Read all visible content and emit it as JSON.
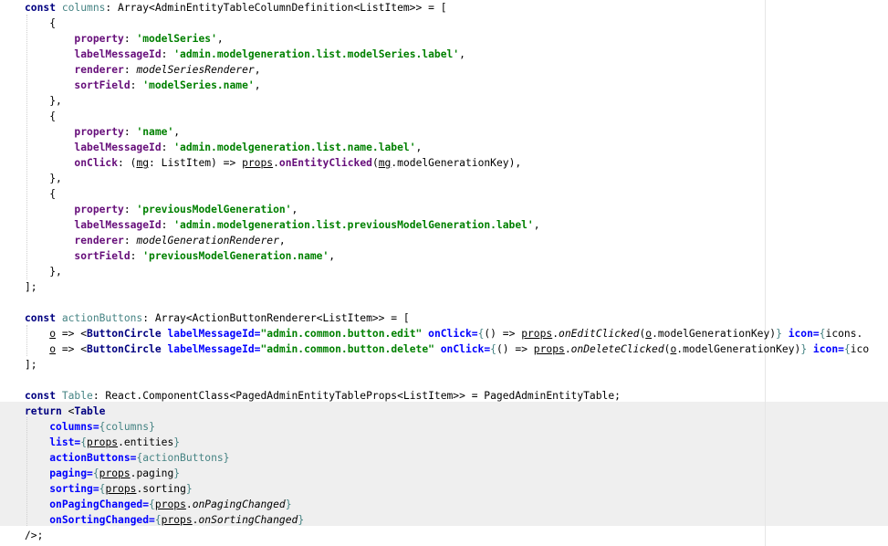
{
  "editor": {
    "lines": [
      [
        {
          "t": "const ",
          "c": "kw"
        },
        {
          "t": "columns",
          "c": "dec"
        },
        {
          "t": ": Array<AdminEntityTableColumnDefinition<ListItem>> = ["
        }
      ],
      [
        {
          "t": "    {"
        }
      ],
      [
        {
          "t": "        "
        },
        {
          "t": "property",
          "c": "prop"
        },
        {
          "t": ": "
        },
        {
          "t": "'modelSeries'",
          "c": "str"
        },
        {
          "t": ","
        }
      ],
      [
        {
          "t": "        "
        },
        {
          "t": "labelMessageId",
          "c": "prop"
        },
        {
          "t": ": "
        },
        {
          "t": "'admin.modelgeneration.list.modelSeries.label'",
          "c": "str"
        },
        {
          "t": ","
        }
      ],
      [
        {
          "t": "        "
        },
        {
          "t": "renderer",
          "c": "prop"
        },
        {
          "t": ": "
        },
        {
          "t": "modelSeriesRenderer",
          "c": "ital"
        },
        {
          "t": ","
        }
      ],
      [
        {
          "t": "        "
        },
        {
          "t": "sortField",
          "c": "prop"
        },
        {
          "t": ": "
        },
        {
          "t": "'modelSeries.name'",
          "c": "str"
        },
        {
          "t": ","
        }
      ],
      [
        {
          "t": "    },"
        }
      ],
      [
        {
          "t": "    {"
        }
      ],
      [
        {
          "t": "        "
        },
        {
          "t": "property",
          "c": "prop"
        },
        {
          "t": ": "
        },
        {
          "t": "'name'",
          "c": "str"
        },
        {
          "t": ","
        }
      ],
      [
        {
          "t": "        "
        },
        {
          "t": "labelMessageId",
          "c": "prop"
        },
        {
          "t": ": "
        },
        {
          "t": "'admin.modelgeneration.list.name.label'",
          "c": "str"
        },
        {
          "t": ","
        }
      ],
      [
        {
          "t": "        "
        },
        {
          "t": "onClick",
          "c": "prop"
        },
        {
          "t": ": ("
        },
        {
          "t": "mg",
          "c": "ul"
        },
        {
          "t": ": ListItem) => "
        },
        {
          "t": "props",
          "c": "ul"
        },
        {
          "t": "."
        },
        {
          "t": "onEntityClicked",
          "c": "prop"
        },
        {
          "t": "("
        },
        {
          "t": "mg",
          "c": "ul"
        },
        {
          "t": ".modelGenerationKey),"
        }
      ],
      [
        {
          "t": "    },"
        }
      ],
      [
        {
          "t": "    {"
        }
      ],
      [
        {
          "t": "        "
        },
        {
          "t": "property",
          "c": "prop"
        },
        {
          "t": ": "
        },
        {
          "t": "'previousModelGeneration'",
          "c": "str"
        },
        {
          "t": ","
        }
      ],
      [
        {
          "t": "        "
        },
        {
          "t": "labelMessageId",
          "c": "prop"
        },
        {
          "t": ": "
        },
        {
          "t": "'admin.modelgeneration.list.previousModelGeneration.label'",
          "c": "str"
        },
        {
          "t": ","
        }
      ],
      [
        {
          "t": "        "
        },
        {
          "t": "renderer",
          "c": "prop"
        },
        {
          "t": ": "
        },
        {
          "t": "modelGenerationRenderer",
          "c": "ital"
        },
        {
          "t": ","
        }
      ],
      [
        {
          "t": "        "
        },
        {
          "t": "sortField",
          "c": "prop"
        },
        {
          "t": ": "
        },
        {
          "t": "'previousModelGeneration.name'",
          "c": "str"
        },
        {
          "t": ","
        }
      ],
      [
        {
          "t": "    },"
        }
      ],
      [
        {
          "t": "];"
        }
      ],
      [
        {
          "t": ""
        }
      ],
      [
        {
          "t": "const ",
          "c": "kw"
        },
        {
          "t": "actionButtons",
          "c": "dec"
        },
        {
          "t": ": Array<ActionButtonRenderer<ListItem>> = ["
        }
      ],
      [
        {
          "t": "    "
        },
        {
          "t": "o",
          "c": "ul"
        },
        {
          "t": " => <"
        },
        {
          "t": "ButtonCircle ",
          "c": "tag"
        },
        {
          "t": "labelMessageId=",
          "c": "attr"
        },
        {
          "t": "\"admin.common.button.edit\" ",
          "c": "str"
        },
        {
          "t": "onClick=",
          "c": "attr"
        },
        {
          "t": "{",
          "c": "brace"
        },
        {
          "t": "() => "
        },
        {
          "t": "props",
          "c": "ul"
        },
        {
          "t": "."
        },
        {
          "t": "onEditClicked",
          "c": "ital"
        },
        {
          "t": "("
        },
        {
          "t": "o",
          "c": "ul"
        },
        {
          "t": ".modelGenerationKey)"
        },
        {
          "t": "} ",
          "c": "brace"
        },
        {
          "t": "icon=",
          "c": "attr"
        },
        {
          "t": "{",
          "c": "brace"
        },
        {
          "t": "icons."
        }
      ],
      [
        {
          "t": "    "
        },
        {
          "t": "o",
          "c": "ul"
        },
        {
          "t": " => <"
        },
        {
          "t": "ButtonCircle ",
          "c": "tag"
        },
        {
          "t": "labelMessageId=",
          "c": "attr"
        },
        {
          "t": "\"admin.common.button.delete\" ",
          "c": "str"
        },
        {
          "t": "onClick=",
          "c": "attr"
        },
        {
          "t": "{",
          "c": "brace"
        },
        {
          "t": "() => "
        },
        {
          "t": "props",
          "c": "ul"
        },
        {
          "t": "."
        },
        {
          "t": "onDeleteClicked",
          "c": "ital"
        },
        {
          "t": "("
        },
        {
          "t": "o",
          "c": "ul"
        },
        {
          "t": ".modelGenerationKey)"
        },
        {
          "t": "} ",
          "c": "brace"
        },
        {
          "t": "icon=",
          "c": "attr"
        },
        {
          "t": "{",
          "c": "brace"
        },
        {
          "t": "ico"
        }
      ],
      [
        {
          "t": "];"
        }
      ],
      [
        {
          "t": ""
        }
      ],
      [
        {
          "t": "const ",
          "c": "kw"
        },
        {
          "t": "Table",
          "c": "dec"
        },
        {
          "t": ": React.ComponentClass<PagedAdminEntityTableProps<ListItem>> = PagedAdminEntityTable;"
        }
      ],
      [
        {
          "t": "return ",
          "c": "kw"
        },
        {
          "t": "<"
        },
        {
          "t": "Table",
          "c": "tag"
        }
      ],
      [
        {
          "t": "    "
        },
        {
          "t": "columns=",
          "c": "attr"
        },
        {
          "t": "{",
          "c": "brace"
        },
        {
          "t": "columns",
          "c": "dec"
        },
        {
          "t": "}",
          "c": "brace"
        }
      ],
      [
        {
          "t": "    "
        },
        {
          "t": "list=",
          "c": "attr"
        },
        {
          "t": "{",
          "c": "brace"
        },
        {
          "t": "props",
          "c": "ul"
        },
        {
          "t": ".entities"
        },
        {
          "t": "}",
          "c": "brace"
        }
      ],
      [
        {
          "t": "    "
        },
        {
          "t": "actionButtons=",
          "c": "attr"
        },
        {
          "t": "{",
          "c": "brace"
        },
        {
          "t": "actionButtons",
          "c": "dec"
        },
        {
          "t": "}",
          "c": "brace"
        }
      ],
      [
        {
          "t": "    "
        },
        {
          "t": "paging=",
          "c": "attr"
        },
        {
          "t": "{",
          "c": "brace"
        },
        {
          "t": "props",
          "c": "ul"
        },
        {
          "t": ".paging"
        },
        {
          "t": "}",
          "c": "brace"
        }
      ],
      [
        {
          "t": "    "
        },
        {
          "t": "sorting=",
          "c": "attr"
        },
        {
          "t": "{",
          "c": "brace"
        },
        {
          "t": "props",
          "c": "ul"
        },
        {
          "t": ".sorting"
        },
        {
          "t": "}",
          "c": "brace"
        }
      ],
      [
        {
          "t": "    "
        },
        {
          "t": "onPagingChanged=",
          "c": "attr"
        },
        {
          "t": "{",
          "c": "brace"
        },
        {
          "t": "props",
          "c": "ul"
        },
        {
          "t": "."
        },
        {
          "t": "onPagingChanged",
          "c": "ital"
        },
        {
          "t": "}",
          "c": "brace"
        }
      ],
      [
        {
          "t": "    "
        },
        {
          "t": "onSortingChanged=",
          "c": "attr"
        },
        {
          "t": "{",
          "c": "brace"
        },
        {
          "t": "props",
          "c": "ul"
        },
        {
          "t": "."
        },
        {
          "t": "onSortingChanged",
          "c": "ital"
        },
        {
          "t": "}",
          "c": "brace"
        }
      ],
      [
        {
          "t": "/>;"
        }
      ]
    ]
  }
}
